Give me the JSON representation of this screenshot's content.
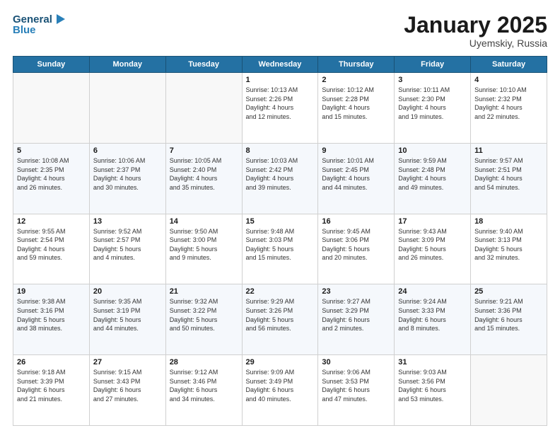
{
  "header": {
    "logo_line1": "General",
    "logo_line2": "Blue",
    "title": "January 2025",
    "subtitle": "Uyemskiy, Russia"
  },
  "weekdays": [
    "Sunday",
    "Monday",
    "Tuesday",
    "Wednesday",
    "Thursday",
    "Friday",
    "Saturday"
  ],
  "weeks": [
    [
      {
        "day": "",
        "info": ""
      },
      {
        "day": "",
        "info": ""
      },
      {
        "day": "",
        "info": ""
      },
      {
        "day": "1",
        "info": "Sunrise: 10:13 AM\nSunset: 2:26 PM\nDaylight: 4 hours\nand 12 minutes."
      },
      {
        "day": "2",
        "info": "Sunrise: 10:12 AM\nSunset: 2:28 PM\nDaylight: 4 hours\nand 15 minutes."
      },
      {
        "day": "3",
        "info": "Sunrise: 10:11 AM\nSunset: 2:30 PM\nDaylight: 4 hours\nand 19 minutes."
      },
      {
        "day": "4",
        "info": "Sunrise: 10:10 AM\nSunset: 2:32 PM\nDaylight: 4 hours\nand 22 minutes."
      }
    ],
    [
      {
        "day": "5",
        "info": "Sunrise: 10:08 AM\nSunset: 2:35 PM\nDaylight: 4 hours\nand 26 minutes."
      },
      {
        "day": "6",
        "info": "Sunrise: 10:06 AM\nSunset: 2:37 PM\nDaylight: 4 hours\nand 30 minutes."
      },
      {
        "day": "7",
        "info": "Sunrise: 10:05 AM\nSunset: 2:40 PM\nDaylight: 4 hours\nand 35 minutes."
      },
      {
        "day": "8",
        "info": "Sunrise: 10:03 AM\nSunset: 2:42 PM\nDaylight: 4 hours\nand 39 minutes."
      },
      {
        "day": "9",
        "info": "Sunrise: 10:01 AM\nSunset: 2:45 PM\nDaylight: 4 hours\nand 44 minutes."
      },
      {
        "day": "10",
        "info": "Sunrise: 9:59 AM\nSunset: 2:48 PM\nDaylight: 4 hours\nand 49 minutes."
      },
      {
        "day": "11",
        "info": "Sunrise: 9:57 AM\nSunset: 2:51 PM\nDaylight: 4 hours\nand 54 minutes."
      }
    ],
    [
      {
        "day": "12",
        "info": "Sunrise: 9:55 AM\nSunset: 2:54 PM\nDaylight: 4 hours\nand 59 minutes."
      },
      {
        "day": "13",
        "info": "Sunrise: 9:52 AM\nSunset: 2:57 PM\nDaylight: 5 hours\nand 4 minutes."
      },
      {
        "day": "14",
        "info": "Sunrise: 9:50 AM\nSunset: 3:00 PM\nDaylight: 5 hours\nand 9 minutes."
      },
      {
        "day": "15",
        "info": "Sunrise: 9:48 AM\nSunset: 3:03 PM\nDaylight: 5 hours\nand 15 minutes."
      },
      {
        "day": "16",
        "info": "Sunrise: 9:45 AM\nSunset: 3:06 PM\nDaylight: 5 hours\nand 20 minutes."
      },
      {
        "day": "17",
        "info": "Sunrise: 9:43 AM\nSunset: 3:09 PM\nDaylight: 5 hours\nand 26 minutes."
      },
      {
        "day": "18",
        "info": "Sunrise: 9:40 AM\nSunset: 3:13 PM\nDaylight: 5 hours\nand 32 minutes."
      }
    ],
    [
      {
        "day": "19",
        "info": "Sunrise: 9:38 AM\nSunset: 3:16 PM\nDaylight: 5 hours\nand 38 minutes."
      },
      {
        "day": "20",
        "info": "Sunrise: 9:35 AM\nSunset: 3:19 PM\nDaylight: 5 hours\nand 44 minutes."
      },
      {
        "day": "21",
        "info": "Sunrise: 9:32 AM\nSunset: 3:22 PM\nDaylight: 5 hours\nand 50 minutes."
      },
      {
        "day": "22",
        "info": "Sunrise: 9:29 AM\nSunset: 3:26 PM\nDaylight: 5 hours\nand 56 minutes."
      },
      {
        "day": "23",
        "info": "Sunrise: 9:27 AM\nSunset: 3:29 PM\nDaylight: 6 hours\nand 2 minutes."
      },
      {
        "day": "24",
        "info": "Sunrise: 9:24 AM\nSunset: 3:33 PM\nDaylight: 6 hours\nand 8 minutes."
      },
      {
        "day": "25",
        "info": "Sunrise: 9:21 AM\nSunset: 3:36 PM\nDaylight: 6 hours\nand 15 minutes."
      }
    ],
    [
      {
        "day": "26",
        "info": "Sunrise: 9:18 AM\nSunset: 3:39 PM\nDaylight: 6 hours\nand 21 minutes."
      },
      {
        "day": "27",
        "info": "Sunrise: 9:15 AM\nSunset: 3:43 PM\nDaylight: 6 hours\nand 27 minutes."
      },
      {
        "day": "28",
        "info": "Sunrise: 9:12 AM\nSunset: 3:46 PM\nDaylight: 6 hours\nand 34 minutes."
      },
      {
        "day": "29",
        "info": "Sunrise: 9:09 AM\nSunset: 3:49 PM\nDaylight: 6 hours\nand 40 minutes."
      },
      {
        "day": "30",
        "info": "Sunrise: 9:06 AM\nSunset: 3:53 PM\nDaylight: 6 hours\nand 47 minutes."
      },
      {
        "day": "31",
        "info": "Sunrise: 9:03 AM\nSunset: 3:56 PM\nDaylight: 6 hours\nand 53 minutes."
      },
      {
        "day": "",
        "info": ""
      }
    ]
  ]
}
